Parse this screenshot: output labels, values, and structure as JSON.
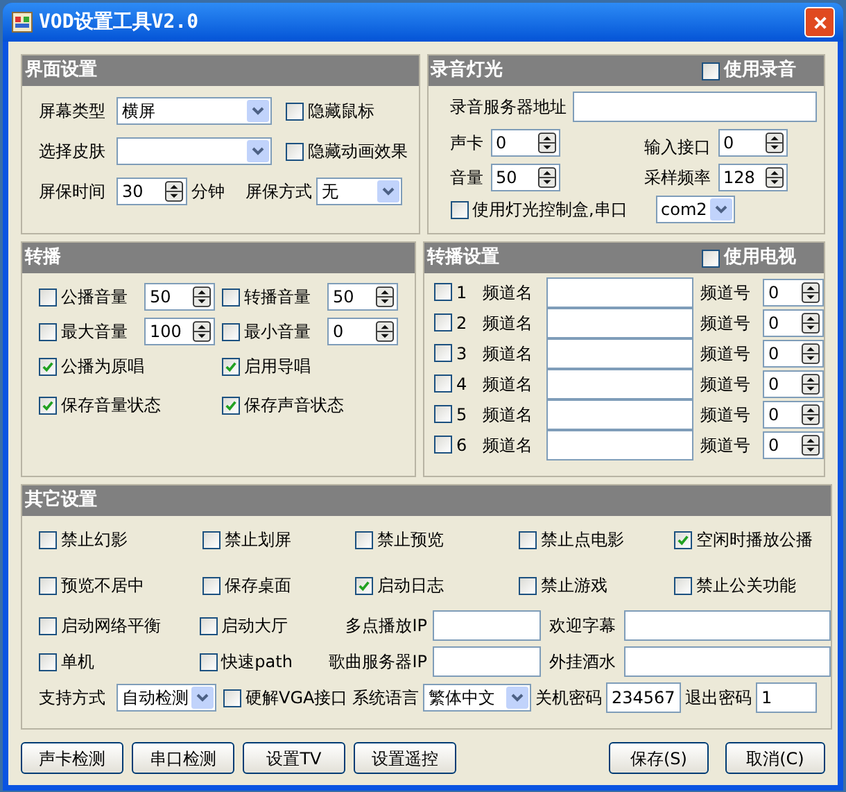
{
  "window": {
    "title": "VOD设置工具V2.0"
  },
  "interface_panel": {
    "title": "界面设置",
    "screen_type": {
      "label": "屏幕类型",
      "value": "横屏"
    },
    "hide_mouse": {
      "label": "隐藏鼠标",
      "checked": false
    },
    "skin": {
      "label": "选择皮肤"
    },
    "hide_animation": {
      "label": "隐藏动画效果",
      "checked": false
    },
    "saver_time": {
      "label": "屏保时间",
      "value": "30",
      "unit": "分钟"
    },
    "saver_mode": {
      "label": "屏保方式",
      "value": "无"
    }
  },
  "recording_panel": {
    "title": "录音灯光",
    "use_recording": {
      "label": "使用录音",
      "checked": false
    },
    "server": {
      "label": "录音服务器地址"
    },
    "sound_card": {
      "label": "声卡",
      "value": "0"
    },
    "input_port": {
      "label": "输入接口",
      "value": "0"
    },
    "volume": {
      "label": "音量",
      "value": "50"
    },
    "sample_rate": {
      "label": "采样频率",
      "value": "128"
    },
    "light_box": {
      "label": "使用灯光控制盒,串口",
      "checked": false
    },
    "port": {
      "value": "com2"
    }
  },
  "relay_panel": {
    "title": "转播",
    "items": [
      {
        "kind": "spin",
        "label": "公播音量",
        "checked": false,
        "value": "50"
      },
      {
        "kind": "spin",
        "label": "转播音量",
        "checked": false,
        "value": "50"
      },
      {
        "kind": "spin",
        "label": "最大音量",
        "checked": false,
        "value": "100"
      },
      {
        "kind": "spin",
        "label": "最小音量",
        "checked": false,
        "value": "0"
      },
      {
        "kind": "check",
        "label": "公播为原唱",
        "checked": true
      },
      {
        "kind": "check",
        "label": "启用导唱",
        "checked": true
      },
      {
        "kind": "check",
        "label": "保存音量状态",
        "checked": true
      },
      {
        "kind": "check",
        "label": "保存声音状态",
        "checked": true
      }
    ]
  },
  "relay_settings_panel": {
    "title": "转播设置",
    "use_tv": {
      "label": "使用电视",
      "checked": false
    },
    "channels": [
      {
        "number": "1",
        "checked": false,
        "name_label": "频道名",
        "number_label": "频道号",
        "value": "0"
      },
      {
        "number": "2",
        "checked": false,
        "name_label": "频道名",
        "number_label": "频道号",
        "value": "0"
      },
      {
        "number": "3",
        "checked": false,
        "name_label": "频道名",
        "number_label": "频道号",
        "value": "0"
      },
      {
        "number": "4",
        "checked": false,
        "name_label": "频道名",
        "number_label": "频道号",
        "value": "0"
      },
      {
        "number": "5",
        "checked": false,
        "name_label": "频道名",
        "number_label": "频道号",
        "value": "0"
      },
      {
        "number": "6",
        "checked": false,
        "name_label": "频道名",
        "number_label": "频道号",
        "value": "0"
      }
    ]
  },
  "other_panel": {
    "title": "其它设置",
    "checkboxes": [
      {
        "label": "禁止幻影",
        "checked": false
      },
      {
        "label": "禁止划屏",
        "checked": false
      },
      {
        "label": "禁止预览",
        "checked": false
      },
      {
        "label": "禁止点电影",
        "checked": false
      },
      {
        "label": "空闲时播放公播",
        "checked": true
      },
      {
        "label": "预览不居中",
        "checked": false
      },
      {
        "label": "保存桌面",
        "checked": false
      },
      {
        "label": "启动日志",
        "checked": true
      },
      {
        "label": "禁止游戏",
        "checked": false
      },
      {
        "label": "禁止公关功能",
        "checked": false
      }
    ],
    "network_balance": {
      "label": "启动网络平衡",
      "checked": false
    },
    "lobby": {
      "label": "启动大厅",
      "checked": false
    },
    "multicast_ip": {
      "label": "多点播放IP"
    },
    "welcome_text": {
      "label": "欢迎字幕"
    },
    "standalone": {
      "label": "单机",
      "checked": false
    },
    "fast_path": {
      "label": "快速path",
      "checked": false
    },
    "song_server_ip": {
      "label": "歌曲服务器IP"
    },
    "drinks": {
      "label": "外挂酒水"
    },
    "support_mode": {
      "label": "支持方式",
      "value": "自动检测"
    },
    "vga": {
      "label": "硬解VGA接口",
      "checked": false
    },
    "language": {
      "label": "系统语言",
      "value": "繁体中文"
    },
    "shutdown_password": {
      "label": "关机密码",
      "value": "234567"
    },
    "exit_password": {
      "label": "退出密码",
      "value": "1"
    }
  },
  "left_buttons": [
    "声卡检测",
    "串口检测",
    "设置TV",
    "设置遥控"
  ],
  "right_buttons": [
    "保存(S)",
    "取消(C)"
  ]
}
